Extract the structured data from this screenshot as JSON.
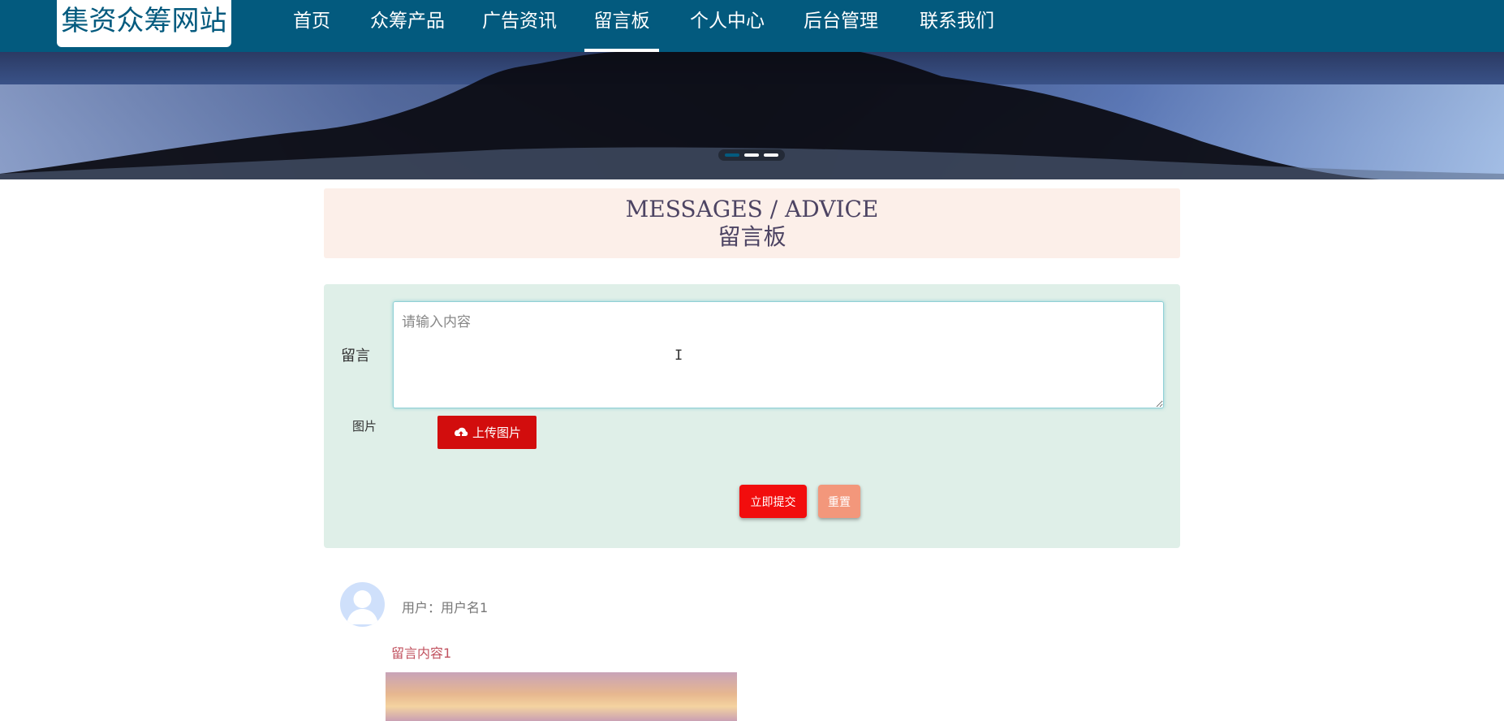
{
  "site": {
    "logo": "集资众筹网站"
  },
  "nav": {
    "items": [
      {
        "label": "首页"
      },
      {
        "label": "众筹产品"
      },
      {
        "label": "广告资讯"
      },
      {
        "label": "留言板",
        "active": true
      },
      {
        "label": "个人中心"
      },
      {
        "label": "后台管理"
      },
      {
        "label": "联系我们"
      }
    ]
  },
  "banner": {
    "slide_count": 3,
    "active_slide": 1
  },
  "heading": {
    "en": "MESSAGES / ADVICE",
    "cn": "留言板"
  },
  "form": {
    "message_label": "留言",
    "message_placeholder": "请输入内容",
    "message_value": "",
    "image_label": "图片",
    "upload_label": "上传图片",
    "upload_icon": "cloud-upload-icon",
    "submit_label": "立即提交",
    "reset_label": "重置"
  },
  "comments": [
    {
      "user": "用户：用户名1",
      "content": "留言内容1",
      "avatar_icon": "user-avatar-icon"
    }
  ],
  "colors": {
    "nav_bg": "#035a7e",
    "title_bg": "#fcefe9",
    "form_bg": "#dfefe8",
    "upload_btn": "#d20d0d",
    "submit_btn": "#f20d0d",
    "reset_btn": "#f3977b",
    "comment_text": "#c1525f"
  }
}
